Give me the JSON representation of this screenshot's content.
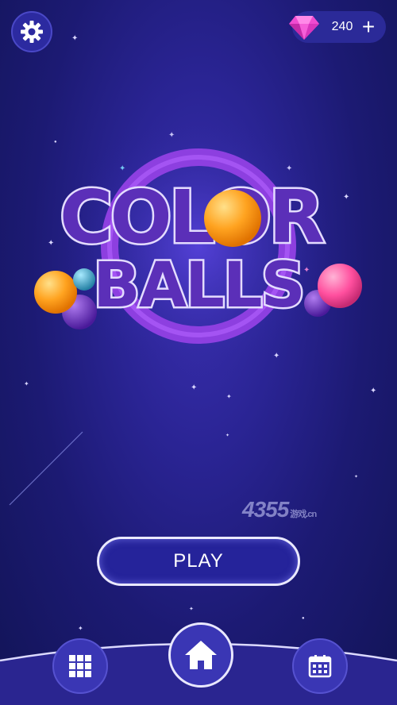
{
  "header": {
    "gem_count": "240",
    "plus_label": "+"
  },
  "logo": {
    "line1": "COLOR",
    "line2": "BALLS"
  },
  "watermark": {
    "number": "4355",
    "suffix": "游戏.cn"
  },
  "play_button": {
    "label": "PLAY"
  },
  "colors": {
    "background": "#1c1a73",
    "accent_purple": "#9b4de0",
    "gem_pink": "#f04bd0",
    "ball_orange": "#ffa320",
    "ball_pink": "#ff4f9e",
    "ball_teal": "#3aa5c6",
    "ball_violet": "#6a2cc0"
  },
  "icons": [
    "gear-icon",
    "gem-icon",
    "plus-icon",
    "grid-icon",
    "home-icon",
    "calendar-icon"
  ]
}
